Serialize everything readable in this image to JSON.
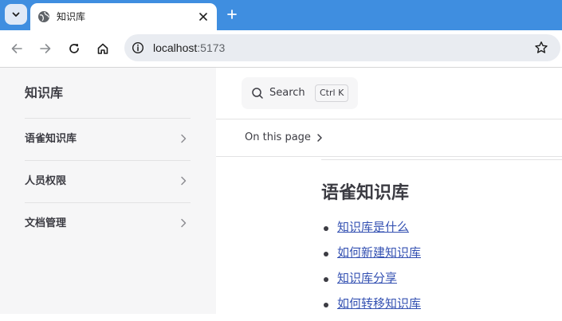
{
  "browser": {
    "tab_title": "知识库",
    "url_host": "localhost",
    "url_port": ":5173"
  },
  "sidebar": {
    "title": "知识库",
    "items": [
      {
        "label": "语雀知识库"
      },
      {
        "label": "人员权限"
      },
      {
        "label": "文档管理"
      }
    ]
  },
  "search": {
    "label": "Search",
    "shortcut": "Ctrl K"
  },
  "outline": {
    "label": "On this page"
  },
  "content": {
    "title": "语雀知识库",
    "links": [
      "知识库是什么",
      "如何新建知识库",
      "知识库分享",
      "如何转移知识库"
    ]
  },
  "colors": {
    "tabstrip": "#3f8ee0",
    "sidebar_bg": "#f6f6f7",
    "link": "#3451b2",
    "text": "#3c3c43"
  }
}
